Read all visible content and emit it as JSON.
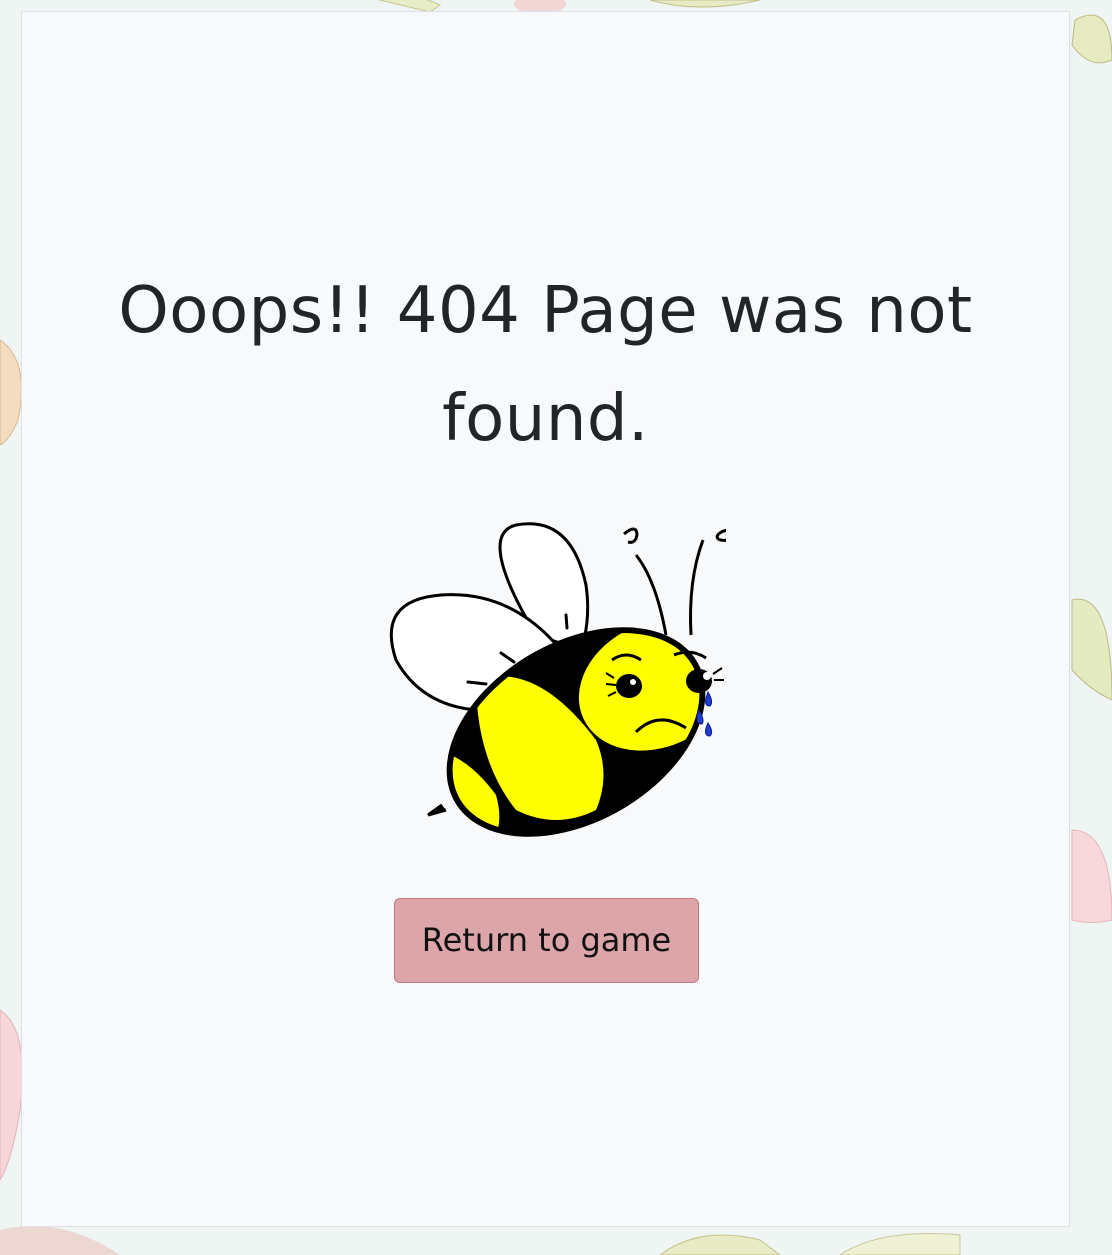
{
  "message": {
    "title": "Ooops!! 404 Page was not found."
  },
  "illustration": {
    "name": "crying-bee",
    "colors": {
      "body": "#ffff00",
      "stripes": "#000000",
      "tears": "#1f3ccf",
      "wings": "#ffffff"
    }
  },
  "actions": {
    "return_label": "Return to game"
  },
  "colors": {
    "card_background": "#f8f9fa",
    "button_background": "#dca5aa",
    "button_border": "#c27880",
    "text": "#212529"
  }
}
